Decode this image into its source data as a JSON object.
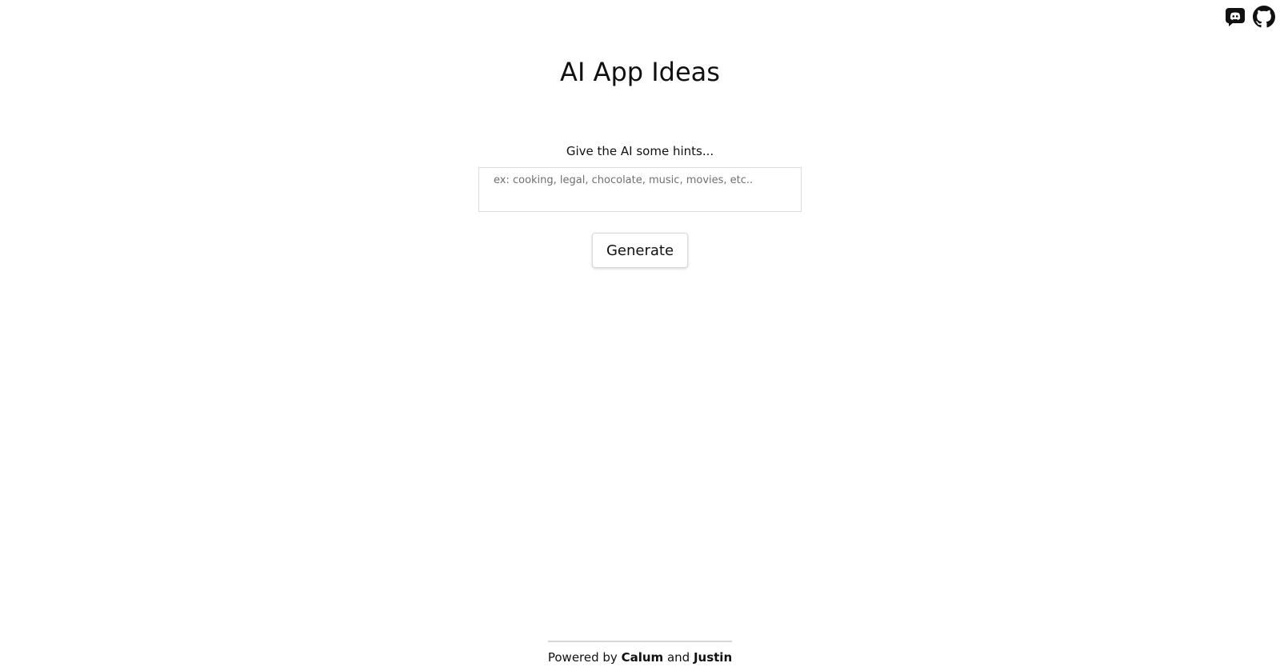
{
  "header": {
    "icons": [
      {
        "name": "discord-icon",
        "color": "#111111"
      },
      {
        "name": "github-icon",
        "color": "#111111"
      }
    ]
  },
  "main": {
    "title": "AI App Ideas",
    "hint_label": "Give the AI some hints...",
    "hint_input": {
      "value": "",
      "placeholder": "ex: cooking, legal, chocolate, music, movies, etc.."
    },
    "generate_label": "Generate"
  },
  "footer": {
    "prefix": "Powered by ",
    "name1": "Calum",
    "connector": " and ",
    "name2": "Justin"
  }
}
